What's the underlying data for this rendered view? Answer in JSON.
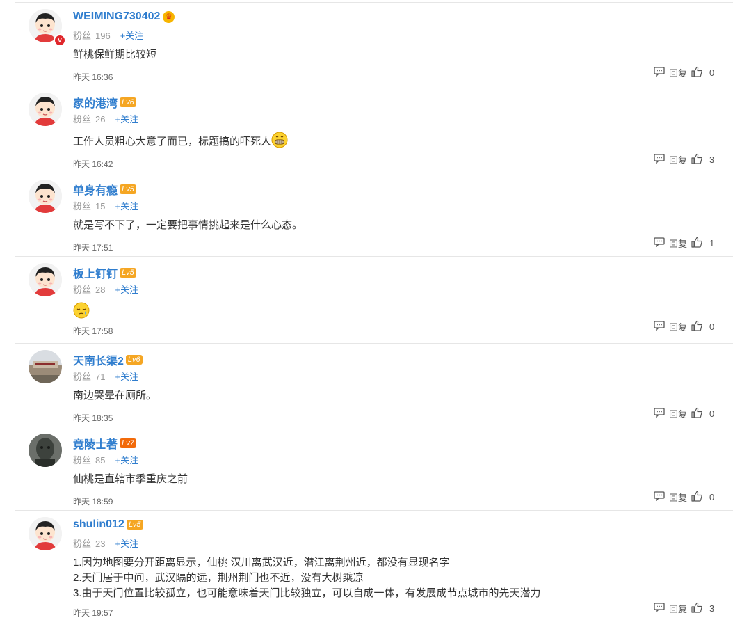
{
  "fans_label": "粉丝",
  "follow_label": "+关注",
  "reply_label": "回复",
  "comments": [
    {
      "username": "WEIMING730402",
      "level": "",
      "crown_icon": "crown-icon",
      "verified_badge": "V",
      "fans": "196",
      "text": [
        "鲜桃保鲜期比较短"
      ],
      "time": "昨天 16:36",
      "likes": "0",
      "avatar": "cartoon-boy"
    },
    {
      "username": "家的港湾",
      "level": "Lv6",
      "fans": "26",
      "text": [
        "工作人员粗心大意了而已，标题搞的吓死人"
      ],
      "emoji": "grin-emoji",
      "time": "昨天 16:42",
      "likes": "3",
      "avatar": "cartoon-boy"
    },
    {
      "username": "单身有瘾",
      "level": "Lv5",
      "fans": "15",
      "text": [
        "就是写不下了，一定要把事情挑起来是什么心态。"
      ],
      "time": "昨天 17:51",
      "likes": "1",
      "avatar": "cartoon-boy"
    },
    {
      "username": "板上钉钉",
      "level": "Lv5",
      "fans": "28",
      "text": [
        ""
      ],
      "emoji": "sleepy-emoji",
      "time": "昨天 17:58",
      "likes": "0",
      "avatar": "cartoon-boy"
    },
    {
      "username": "天南长渠2",
      "level": "Lv6",
      "fans": "71",
      "text": [
        "南边哭晕在厕所。"
      ],
      "time": "昨天 18:35",
      "likes": "0",
      "avatar": "landscape-photo"
    },
    {
      "username": "竟陵士著",
      "level": "Lv7",
      "fans": "85",
      "text": [
        "仙桃是直辖市季重庆之前"
      ],
      "time": "昨天 18:59",
      "likes": "0",
      "avatar": "statue-photo"
    },
    {
      "username": "shulin012",
      "level": "Lv5",
      "fans": "23",
      "text": [
        "1.因为地图要分开距离显示，仙桃 汉川离武汉近，潜江离荆州近，都没有显现名字",
        "2.天门居于中间，武汉隔的远，荆州荆门也不近，没有大树乘凉",
        "3.由于天门位置比较孤立，也可能意味着天门比较独立，可以自成一体，有发展成节点城市的先天潜力"
      ],
      "time": "昨天 19:57",
      "likes": "3",
      "avatar": "cartoon-boy"
    }
  ],
  "colors": {
    "username": "#2f7dce",
    "level_badge": "#f5a623",
    "level_badge_high": "#f26a0a",
    "divider": "#e6e6e6"
  }
}
